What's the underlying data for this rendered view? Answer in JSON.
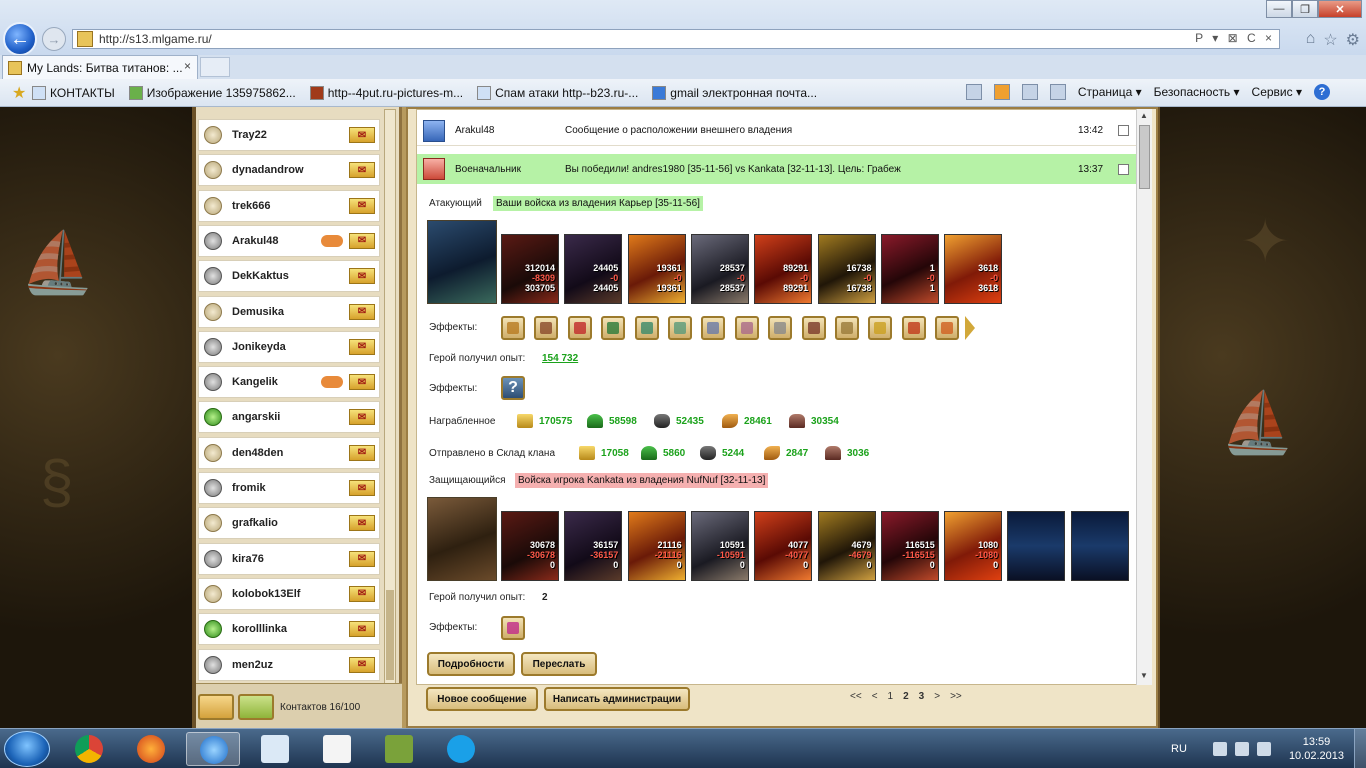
{
  "browser": {
    "url": "http://s13.mlgame.ru/",
    "tab_title": "My Lands: Битва титанов: ...",
    "tab_close": "×",
    "back_icon": "←",
    "forward_icon": "→",
    "addr_tools": "P ▾ ⊠ C ×",
    "window_buttons": {
      "minimize": "—",
      "maximize": "❐",
      "close": "✕"
    }
  },
  "favorites": [
    {
      "label": "КОНТАКТЫ"
    },
    {
      "label": "Изображение 135975862..."
    },
    {
      "label": "http--4put.ru-pictures-m..."
    },
    {
      "label": "Спам атаки http--b23.ru-..."
    },
    {
      "label": "gmail электронная почта..."
    }
  ],
  "commandbar": {
    "page": "Страница ▾",
    "security": "Безопасность ▾",
    "tools": "Сервис ▾",
    "help": "?"
  },
  "contacts": {
    "items": [
      {
        "name": "Tray22",
        "status": "normal",
        "handshake": false
      },
      {
        "name": "dynadandrow",
        "status": "normal",
        "handshake": false
      },
      {
        "name": "trek666",
        "status": "normal",
        "handshake": false
      },
      {
        "name": "Arakul48",
        "status": "lock",
        "handshake": true
      },
      {
        "name": "DekKaktus",
        "status": "lock",
        "handshake": false
      },
      {
        "name": "Demusika",
        "status": "normal",
        "handshake": false
      },
      {
        "name": "Jonikeyda",
        "status": "lock",
        "handshake": false
      },
      {
        "name": "Kangelik",
        "status": "lock",
        "handshake": true
      },
      {
        "name": "angarskii",
        "status": "online",
        "handshake": false
      },
      {
        "name": "den48den",
        "status": "normal",
        "handshake": false
      },
      {
        "name": "fromik",
        "status": "lock",
        "handshake": false
      },
      {
        "name": "grafkalio",
        "status": "normal",
        "handshake": false
      },
      {
        "name": "kira76",
        "status": "lock",
        "handshake": false
      },
      {
        "name": "kolobok13Elf",
        "status": "normal",
        "handshake": false
      },
      {
        "name": "korolllinka",
        "status": "online",
        "handshake": false
      },
      {
        "name": "men2uz",
        "status": "lock",
        "handshake": false
      }
    ],
    "count_label": "Контактов 16/100"
  },
  "messages": [
    {
      "from": "Arakul48",
      "subject": "Сообщение о расположении внешнего владения",
      "time": "13:42"
    },
    {
      "from": "Военачальник",
      "subject": "Вы победили! andres1980 [35-11-56] vs Kankata [32-11-13]. Цель: Грабеж",
      "time": "13:37"
    }
  ],
  "battle": {
    "attacker_label": "Атакующий",
    "attacker_tag": "Ваши войска из владения Карьер [35-11-56]",
    "attacker_units": [
      {
        "a": "312014",
        "b": "-8309",
        "c": "303705",
        "skin": "u-dragon"
      },
      {
        "a": "24405",
        "b": "-0",
        "c": "24405",
        "skin": "u-mage"
      },
      {
        "a": "19361",
        "b": "-0",
        "c": "19361",
        "skin": "u-fire"
      },
      {
        "a": "28537",
        "b": "-0",
        "c": "28537",
        "skin": "u-gray"
      },
      {
        "a": "89291",
        "b": "-0",
        "c": "89291",
        "skin": "u-lava"
      },
      {
        "a": "16738",
        "b": "-0",
        "c": "16738",
        "skin": "u-gold"
      },
      {
        "a": "1",
        "b": "-0",
        "c": "1",
        "skin": "u-demon"
      },
      {
        "a": "3618",
        "b": "-0",
        "c": "3618",
        "skin": "u-flame"
      }
    ],
    "effects_label": "Эффекты:",
    "attacker_effects": [
      "#b87a20",
      "#8a4a2a",
      "#c02a2a",
      "#2a7a3a",
      "#3a8a6a",
      "#5a9a7a",
      "#6a7aa8",
      "#aa6a8a",
      "#8a8a8a",
      "#7a3a2a",
      "#9a7a3a",
      "#caa020",
      "#c03a1a",
      "#d06020"
    ],
    "xp_label": "Герой получил опыт:",
    "attacker_xp": "154 732",
    "hero_effects_label": "Эффекты:",
    "hero_effect_mark": "?",
    "loot_label": "Награбленное",
    "loot": [
      {
        "type": "gold",
        "value": "170575"
      },
      {
        "type": "wood",
        "value": "58598"
      },
      {
        "type": "ore",
        "value": "52435"
      },
      {
        "type": "grain",
        "value": "28461"
      },
      {
        "type": "stone",
        "value": "30354"
      }
    ],
    "clan_label": "Отправлено в Склад клана",
    "clan": [
      {
        "type": "gold",
        "value": "17058"
      },
      {
        "type": "wood",
        "value": "5860"
      },
      {
        "type": "ore",
        "value": "5244"
      },
      {
        "type": "grain",
        "value": "2847"
      },
      {
        "type": "stone",
        "value": "3036"
      }
    ],
    "defender_label": "Защищающийся",
    "defender_tag": "Войска игрока Kankata из владения NufNuf [32-11-13]",
    "defender_units": [
      {
        "a": "30678",
        "b": "-30678",
        "c": "0",
        "skin": "u-dragon"
      },
      {
        "a": "36157",
        "b": "-36157",
        "c": "0",
        "skin": "u-mage"
      },
      {
        "a": "21116",
        "b": "-21116",
        "c": "0",
        "skin": "u-fire"
      },
      {
        "a": "10591",
        "b": "-10591",
        "c": "0",
        "skin": "u-gray"
      },
      {
        "a": "4077",
        "b": "-4077",
        "c": "0",
        "skin": "u-lava"
      },
      {
        "a": "4679",
        "b": "-4679",
        "c": "0",
        "skin": "u-gold"
      },
      {
        "a": "116515",
        "b": "-116515",
        "c": "0",
        "skin": "u-demon"
      },
      {
        "a": "1080",
        "b": "-1080",
        "c": "0",
        "skin": "u-flame"
      },
      {
        "a": "",
        "b": "",
        "c": "",
        "skin": "u-tower"
      },
      {
        "a": "",
        "b": "",
        "c": "",
        "skin": "u-tower"
      }
    ],
    "defender_xp": "2"
  },
  "buttons": {
    "details": "Подробности",
    "forward": "Переслать",
    "new_message": "Новое сообщение",
    "write_admin": "Написать администрации"
  },
  "pager": {
    "first": "<<",
    "prev": "<",
    "p1": "1",
    "p2": "2",
    "p3": "3",
    "next": ">",
    "last": ">>"
  },
  "taskbar": {
    "lang": "RU",
    "time": "13:59",
    "date": "10.02.2013"
  }
}
